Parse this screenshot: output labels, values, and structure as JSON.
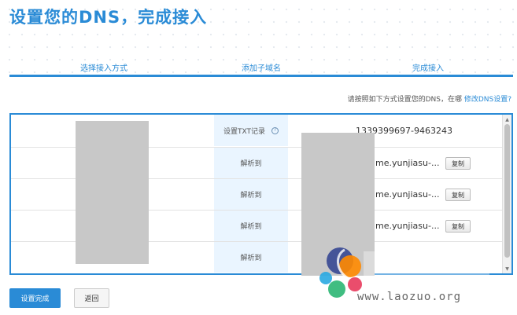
{
  "page": {
    "title": "设置您的DNS，完成接入"
  },
  "steps": [
    "选择接入方式",
    "添加子域名",
    "完成接入"
  ],
  "hint": {
    "text": "请按照如下方式设置您的DNS，在哪",
    "link": "修改DNS设置?"
  },
  "records": [
    {
      "type": "设置TXT记录",
      "has_help_icon": true,
      "value": "1339399697-9463243",
      "copy_label": ""
    },
    {
      "type": "解析到",
      "has_help_icon": false,
      "value": "me.yunjiasu-...",
      "copy_label": "复制"
    },
    {
      "type": "解析到",
      "has_help_icon": false,
      "value": "me.yunjiasu-...",
      "copy_label": "复制"
    },
    {
      "type": "解析到",
      "has_help_icon": false,
      "value": "me.yunjiasu-...",
      "copy_label": "复制"
    },
    {
      "type": "解析到",
      "has_help_icon": false,
      "value": "",
      "copy_label": ""
    }
  ],
  "buttons": {
    "done": "设置完成",
    "back": "返回"
  },
  "watermark": {
    "domain": "www.laozuo.org"
  },
  "colors": {
    "accent": "#2a8bd6",
    "type_bg": "#eaf5ff",
    "mask": "#c8c8c8"
  }
}
